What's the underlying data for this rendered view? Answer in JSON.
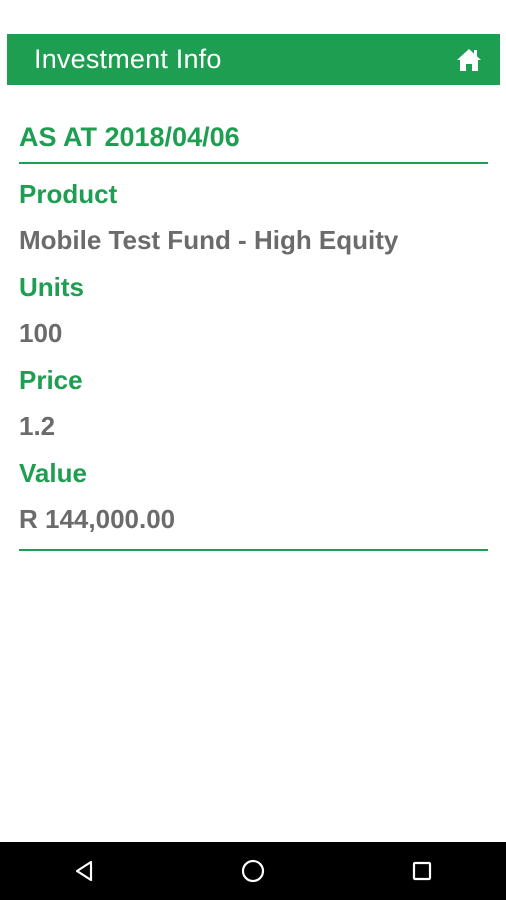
{
  "app_bar": {
    "title": "Investment Info",
    "home_icon": "home-icon",
    "color": "#1e9e50"
  },
  "investment": {
    "as_at": "AS AT 2018/04/06",
    "fields": [
      {
        "label": "Product",
        "value": "Mobile Test Fund - High Equity"
      },
      {
        "label": "Units",
        "value": "100"
      },
      {
        "label": "Price",
        "value": "1.2"
      },
      {
        "label": "Value",
        "value": "R 144,000.00"
      }
    ]
  },
  "nav_bar": {
    "icons": [
      "back-triangle-icon",
      "home-circle-icon",
      "recents-square-icon"
    ]
  },
  "colors": {
    "accent": "#1e9e50",
    "value_text": "#6b6b6b",
    "nav_background": "#000000"
  }
}
